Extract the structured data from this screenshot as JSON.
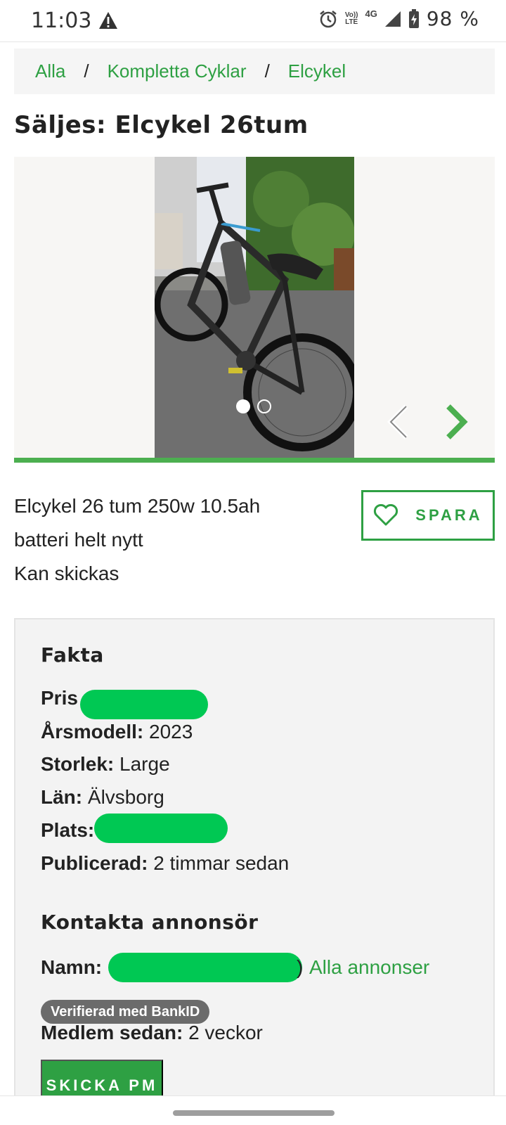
{
  "status_bar": {
    "time": "11:03",
    "warning_icon": "warning-triangle-icon",
    "alarm_icon": "alarm-clock-icon",
    "volte_top": "Vo))",
    "volte_bottom": "LTE",
    "network": "4G",
    "signal_icon": "cell-signal-icon",
    "battery_icon": "battery-charging-icon",
    "battery_text": "98 %"
  },
  "breadcrumb": {
    "items": [
      "Alla",
      "Kompletta Cyklar",
      "Elcykel"
    ],
    "separator": "/"
  },
  "listing": {
    "title": "Säljes: Elcykel 26tum",
    "description_lines": [
      "Elcykel 26 tum 250w 10.5ah",
      "batteri helt nytt",
      "Kan skickas"
    ],
    "save_label": "SPARA",
    "save_icon": "heart-icon"
  },
  "gallery": {
    "image_count": 2,
    "active_index": 0,
    "prev_icon": "chevron-left-icon",
    "next_icon": "chevron-right-icon"
  },
  "fakta": {
    "title": "Fakta",
    "price_label": "Pris",
    "model_year_label": "Årsmodell:",
    "model_year": "2023",
    "size_label": "Storlek:",
    "size": "Large",
    "county_label": "Län:",
    "county": "Älvsborg",
    "place_label": "Plats:",
    "published_label": "Publicerad:",
    "published": "2 timmar sedan"
  },
  "contact": {
    "title": "Kontakta annonsör",
    "name_label": "Namn:",
    "all_ads_link": "Alla annonser",
    "verified_badge": "Verifierad med BankID",
    "member_since_label": "Medlem sedan:",
    "member_since": "2 veckor",
    "pm_button": "SKICKA PM"
  },
  "colors": {
    "accent_green": "#2ea043",
    "redaction_green": "#00c853",
    "badge_gray": "#6b6b6b"
  }
}
